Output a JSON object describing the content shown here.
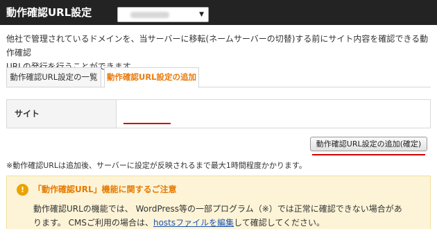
{
  "header": {
    "title": "動作確認URL設定"
  },
  "description": {
    "line1": "他社で管理されているドメインを、当サーバーに移転(ネームサーバーの切替)する前にサイト内容を確認できる動作確認",
    "line2": "URLの発行を行うことができます。"
  },
  "tabs": [
    {
      "label": "動作確認URL設定の一覧",
      "active": false
    },
    {
      "label": "動作確認URL設定の追加",
      "active": true
    }
  ],
  "form": {
    "site_label": "サイト",
    "site_select_arrow": "▼"
  },
  "add_button": {
    "label": "動作確認URL設定の追加(確定)"
  },
  "note": "※動作確認URLは追加後、サーバーに設定が反映されるまで最大1時間程度かかります。",
  "notice": {
    "icon": "!",
    "title": "「動作確認URL」機能に関するご注意",
    "body_line1": "動作確認URLの機能では、 WordPress等の一部プログラム（※）では正常に確認できない場合があ",
    "body_line2_before": "ります。 CMSご利用の場合は、",
    "body_link1": "hostsファイルを編集",
    "body_line2_after": "して確認してください。"
  },
  "colors": {
    "header_bg": "#232323",
    "active_tab": "#e87b0c",
    "notice_bg": "#fdf4d7",
    "notice_title": "#e57a00",
    "annotation_red": "#d00000",
    "link": "#1a53b5"
  }
}
